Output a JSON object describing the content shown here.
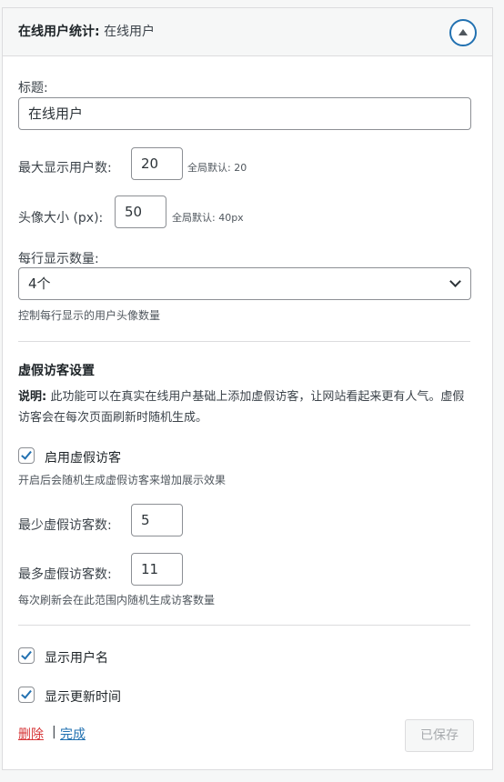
{
  "header": {
    "title": "在线用户统计:",
    "subtitle": "在线用户"
  },
  "fields": {
    "title_label": "标题:",
    "title_value": "在线用户",
    "max_users_label": "最大显示用户数:",
    "max_users_value": "20",
    "max_users_hint": "全局默认: 20",
    "avatar_size_label": "头像大小 (px):",
    "avatar_size_value": "50",
    "avatar_size_hint": "全局默认: 40px",
    "per_row_label": "每行显示数量:",
    "per_row_value": "4个",
    "per_row_desc": "控制每行显示的用户头像数量"
  },
  "fake_visitors": {
    "section_title": "虚假访客设置",
    "note_strong": "说明:",
    "note_text": "此功能可以在真实在线用户基础上添加虚假访客，让网站看起来更有人气。虚假访客会在每次页面刷新时随机生成。",
    "enable_label": "启用虚假访客",
    "enable_checked": true,
    "enable_desc": "开启后会随机生成虚假访客来增加展示效果",
    "min_label": "最少虚假访客数:",
    "min_value": "5",
    "max_label": "最多虚假访客数:",
    "max_value": "11",
    "range_desc": "每次刷新会在此范围内随机生成访客数量"
  },
  "options": {
    "show_username_label": "显示用户名",
    "show_username_checked": true,
    "show_update_time_label": "显示更新时间",
    "show_update_time_checked": true
  },
  "footer": {
    "delete_label": "删除",
    "separator": "|",
    "done_label": "完成",
    "saved_label": "已保存"
  },
  "colors": {
    "accent": "#2271b1",
    "delete": "#d63638"
  }
}
